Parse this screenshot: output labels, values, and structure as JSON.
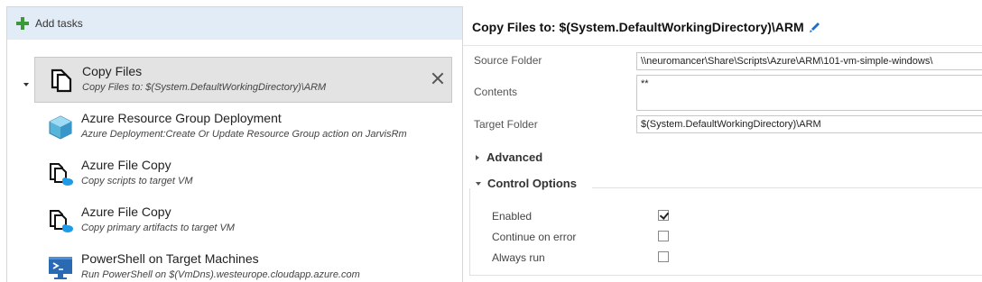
{
  "toolbar": {
    "add_tasks_label": "Add tasks"
  },
  "tasks": [
    {
      "name": "Copy Files",
      "description": "Copy Files to: $(System.DefaultWorkingDirectory)\\ARM",
      "icon": "copy-files-icon",
      "selected": true
    },
    {
      "name": "Azure Resource Group Deployment",
      "description": "Azure Deployment:Create Or Update Resource Group action on JarvisRm",
      "icon": "azure-resource-group-icon"
    },
    {
      "name": "Azure File Copy",
      "description": "Copy scripts to target VM",
      "icon": "azure-file-copy-icon"
    },
    {
      "name": "Azure File Copy",
      "description": "Copy primary artifacts to target VM",
      "icon": "azure-file-copy-icon"
    },
    {
      "name": "PowerShell on Target Machines",
      "description": "Run PowerShell on $(VmDns).westeurope.cloudapp.azure.com",
      "icon": "powershell-icon"
    }
  ],
  "details": {
    "title": "Copy Files to: $(System.DefaultWorkingDirectory)\\ARM",
    "fields": {
      "source_folder": {
        "label": "Source Folder",
        "value": "\\\\neuromancer\\Share\\Scripts\\Azure\\ARM\\101-vm-simple-windows\\"
      },
      "contents": {
        "label": "Contents",
        "value": "**"
      },
      "target_folder": {
        "label": "Target Folder",
        "value": "$(System.DefaultWorkingDirectory)\\ARM"
      }
    },
    "advanced_label": "Advanced",
    "control_options_label": "Control Options",
    "options": [
      {
        "label": "Enabled",
        "checked": true
      },
      {
        "label": "Continue on error",
        "checked": false
      },
      {
        "label": "Always run",
        "checked": false
      }
    ]
  },
  "colors": {
    "accent_blue": "#1e6fc5",
    "add_green": "#3a9a3a",
    "add_bar_bg": "#e2ecf7",
    "selected_bg": "#e3e3e3"
  }
}
